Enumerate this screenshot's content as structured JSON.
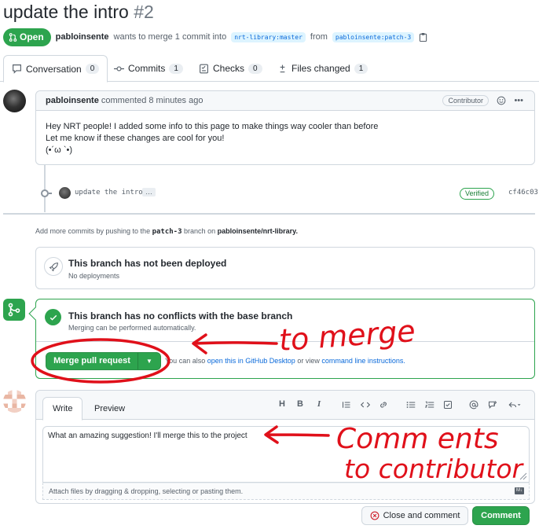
{
  "colors": {
    "open": "#2da44e",
    "link": "#0969da",
    "annotation": "#e0101a",
    "border": "#d0d7de"
  },
  "header": {
    "title": "update the intro",
    "number": "#2",
    "state": "Open",
    "author": "pabloinsente",
    "summary": "wants to merge 1 commit into",
    "base_branch": "nrt-library:master",
    "from_word": "from",
    "head_branch": "pabloinsente:patch-3"
  },
  "tabs": [
    {
      "label": "Conversation",
      "count": "0",
      "icon": "comment-icon"
    },
    {
      "label": "Commits",
      "count": "1",
      "icon": "commit-icon"
    },
    {
      "label": "Checks",
      "count": "0",
      "icon": "checklist-icon"
    },
    {
      "label": "Files changed",
      "count": "1",
      "icon": "diff-icon"
    }
  ],
  "comment": {
    "author": "pabloinsente",
    "meta": "commented 8 minutes ago",
    "role": "Contributor",
    "lines": [
      "Hey NRT people! I added some info to this page to make things way cooler than before",
      "Let me know if these changes are cool for you!",
      "(•´ω `•)"
    ]
  },
  "commit": {
    "message": "update the intro",
    "ellipsis": "…",
    "verified": "Verified",
    "sha": "cf46c03"
  },
  "add_more": {
    "prefix": "Add more commits by pushing to the",
    "branch": "patch-3",
    "middle": "branch on",
    "repo": "pabloinsente/nrt-library."
  },
  "deploy": {
    "title": "This branch has not been deployed",
    "subtitle": "No deployments"
  },
  "merge": {
    "title": "This branch has no conflicts with the base branch",
    "subtitle": "Merging can be performed automatically.",
    "button": "Merge pull request",
    "hint_prefix": "You can also",
    "hint_link1": "open this in GitHub Desktop",
    "hint_middle": "or view",
    "hint_link2": "command line instructions."
  },
  "annotations": {
    "merge_note": "to merge",
    "comment_note_line1": "Comm ents",
    "comment_note_line2": "to contributor"
  },
  "editor": {
    "tab_write": "Write",
    "tab_preview": "Preview",
    "toolbar": [
      "H",
      "B",
      "I"
    ],
    "text": "What an amazing suggestion! I'll merge this to the project",
    "attach_hint": "Attach files by dragging & dropping, selecting or pasting them.",
    "close_button": "Close and comment",
    "comment_button": "Comment"
  }
}
